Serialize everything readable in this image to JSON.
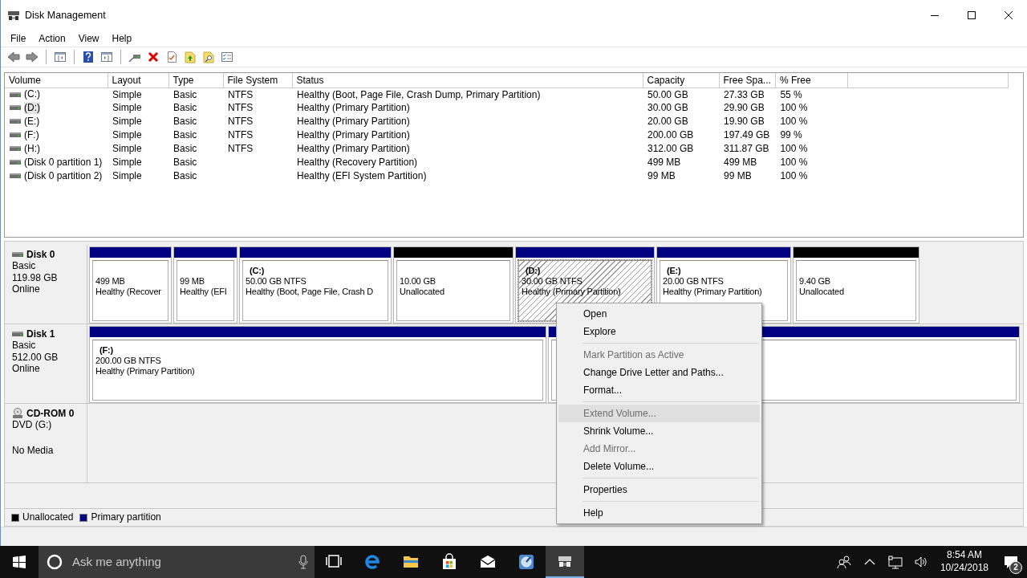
{
  "window": {
    "title": "Disk Management"
  },
  "menu_bar": [
    "File",
    "Action",
    "View",
    "Help"
  ],
  "toolbar": [
    {
      "kind": "back",
      "disabled": false
    },
    {
      "kind": "forward",
      "disabled": false
    },
    {
      "kind": "sep"
    },
    {
      "kind": "console"
    },
    {
      "kind": "sep"
    },
    {
      "kind": "help"
    },
    {
      "kind": "panel"
    },
    {
      "kind": "sep"
    },
    {
      "kind": "connect"
    },
    {
      "kind": "delete"
    },
    {
      "kind": "check"
    },
    {
      "kind": "upfolder"
    },
    {
      "kind": "findfolder"
    },
    {
      "kind": "list"
    }
  ],
  "volume_list": {
    "columns": [
      "Volume",
      "Layout",
      "Type",
      "File System",
      "Status",
      "Capacity",
      "Free Spa...",
      "% Free"
    ],
    "rows": [
      {
        "cells": [
          "(C:)",
          "Simple",
          "Basic",
          "NTFS",
          "Healthy (Boot, Page File, Crash Dump, Primary Partition)",
          "50.00 GB",
          "27.33 GB",
          "55 %"
        ],
        "selected": false
      },
      {
        "cells": [
          "(D:)",
          "Simple",
          "Basic",
          "NTFS",
          "Healthy (Primary Partition)",
          "30.00 GB",
          "29.90 GB",
          "100 %"
        ],
        "selected": true
      },
      {
        "cells": [
          "(E:)",
          "Simple",
          "Basic",
          "NTFS",
          "Healthy (Primary Partition)",
          "20.00 GB",
          "19.90 GB",
          "100 %"
        ],
        "selected": false
      },
      {
        "cells": [
          "(F:)",
          "Simple",
          "Basic",
          "NTFS",
          "Healthy (Primary Partition)",
          "200.00 GB",
          "197.49 GB",
          "99 %"
        ],
        "selected": false
      },
      {
        "cells": [
          "(H:)",
          "Simple",
          "Basic",
          "NTFS",
          "Healthy (Primary Partition)",
          "312.00 GB",
          "311.87 GB",
          "100 %"
        ],
        "selected": false
      },
      {
        "cells": [
          "(Disk 0 partition 1)",
          "Simple",
          "Basic",
          "",
          "Healthy (Recovery Partition)",
          "499 MB",
          "499 MB",
          "100 %"
        ],
        "selected": false
      },
      {
        "cells": [
          "(Disk 0 partition 2)",
          "Simple",
          "Basic",
          "",
          "Healthy (EFI System Partition)",
          "99 MB",
          "99 MB",
          "100 %"
        ],
        "selected": false
      }
    ]
  },
  "disks": [
    {
      "kind": "disk",
      "name": "Disk 0",
      "lines": [
        "Basic",
        "119.98 GB",
        "Online"
      ],
      "partitions": [
        {
          "kind": "primary",
          "size": "499 MB",
          "status": "Healthy (Recover",
          "selected": false
        },
        {
          "kind": "primary",
          "size": "99 MB",
          "status": "Healthy (EFI",
          "selected": false
        },
        {
          "kind": "primary",
          "label": "(C:)",
          "size": "50.00 GB NTFS",
          "status": "Healthy (Boot, Page File, Crash D",
          "selected": false
        },
        {
          "kind": "unallocated",
          "size": "10.00 GB",
          "status": "Unallocated",
          "selected": false
        },
        {
          "kind": "primary",
          "label": "(D:)",
          "size": "30.00 GB NTFS",
          "status": "Healthy (Primary Partition)",
          "selected": true
        },
        {
          "kind": "primary",
          "label": "(E:)",
          "size": "20.00 GB NTFS",
          "status": "Healthy (Primary Partition)",
          "selected": false
        },
        {
          "kind": "unallocated",
          "size": "9.40 GB",
          "status": "Unallocated",
          "selected": false
        }
      ]
    },
    {
      "kind": "disk",
      "name": "Disk 1",
      "lines": [
        "Basic",
        "512.00 GB",
        "Online"
      ],
      "partitions": [
        {
          "kind": "primary",
          "label": "(F:)",
          "size": "200.00 GB NTFS",
          "status": "Healthy (Primary Partition)",
          "selected": false
        },
        {
          "kind": "primary",
          "selected": false
        }
      ]
    },
    {
      "kind": "cdrom",
      "name": "CD-ROM 0",
      "lines": [
        "DVD (G:)",
        "No Media"
      ]
    }
  ],
  "legend": [
    {
      "label": "Unallocated",
      "color": "#000000"
    },
    {
      "label": "Primary partition",
      "color": "#000080"
    }
  ],
  "context_menu": [
    {
      "kind": "item",
      "label": "Open",
      "disabled": false,
      "highlighted": false
    },
    {
      "kind": "item",
      "label": "Explore",
      "disabled": false,
      "highlighted": false
    },
    {
      "kind": "separator"
    },
    {
      "kind": "item",
      "label": "Mark Partition as Active",
      "disabled": true,
      "highlighted": false
    },
    {
      "kind": "item",
      "label": "Change Drive Letter and Paths...",
      "disabled": false,
      "highlighted": false
    },
    {
      "kind": "item",
      "label": "Format...",
      "disabled": false,
      "highlighted": false
    },
    {
      "kind": "separator"
    },
    {
      "kind": "item",
      "label": "Extend Volume...",
      "disabled": true,
      "highlighted": true
    },
    {
      "kind": "item",
      "label": "Shrink Volume...",
      "disabled": false,
      "highlighted": false
    },
    {
      "kind": "item",
      "label": "Add Mirror...",
      "disabled": true,
      "highlighted": false
    },
    {
      "kind": "item",
      "label": "Delete Volume...",
      "disabled": false,
      "highlighted": false
    },
    {
      "kind": "separator"
    },
    {
      "kind": "item",
      "label": "Properties",
      "disabled": false,
      "highlighted": false
    },
    {
      "kind": "separator"
    },
    {
      "kind": "item",
      "label": "Help",
      "disabled": false,
      "highlighted": false
    }
  ],
  "taskbar": {
    "search": {
      "placeholder": "Ask me anything"
    },
    "apps": [
      {
        "kind": "taskview",
        "active": false
      },
      {
        "kind": "edge",
        "active": false
      },
      {
        "kind": "explorer",
        "active": false
      },
      {
        "kind": "store",
        "active": false
      },
      {
        "kind": "mail",
        "active": false
      },
      {
        "kind": "disktool",
        "active": false
      },
      {
        "kind": "diskmgmt",
        "active": true
      }
    ],
    "time": "8:54 AM",
    "date": "10/24/2018",
    "notifications": "2"
  }
}
